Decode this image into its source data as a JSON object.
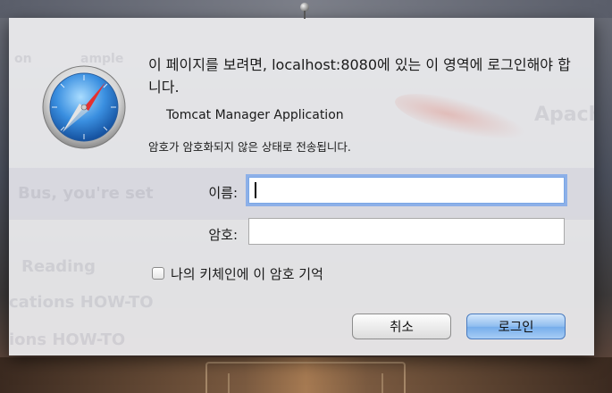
{
  "background": {
    "ghost_texts": [
      "on",
      "ample",
      "Apache",
      "Bus, you're set",
      "Reading",
      "cations HOW-TO",
      "ions HOW-TO"
    ]
  },
  "dialog": {
    "message": "이 페이지를 보려면, localhost:8080에 있는 이 영역에 로그인해야 합니다.",
    "realm": "Tomcat Manager Application",
    "warning": "암호가 암호화되지 않은 상태로 전송됩니다.",
    "username_label": "이름:",
    "username_value": "",
    "password_label": "암호:",
    "password_value": "",
    "remember_label": "나의 키체인에 이 암호 기억",
    "remember_checked": false,
    "cancel_label": "취소",
    "login_label": "로그인"
  },
  "icons": {
    "app": "safari-compass-icon",
    "pin": "pushpin-icon"
  },
  "colors": {
    "login_button": "#8fbdef",
    "focus_ring": "#6ea0eb"
  }
}
